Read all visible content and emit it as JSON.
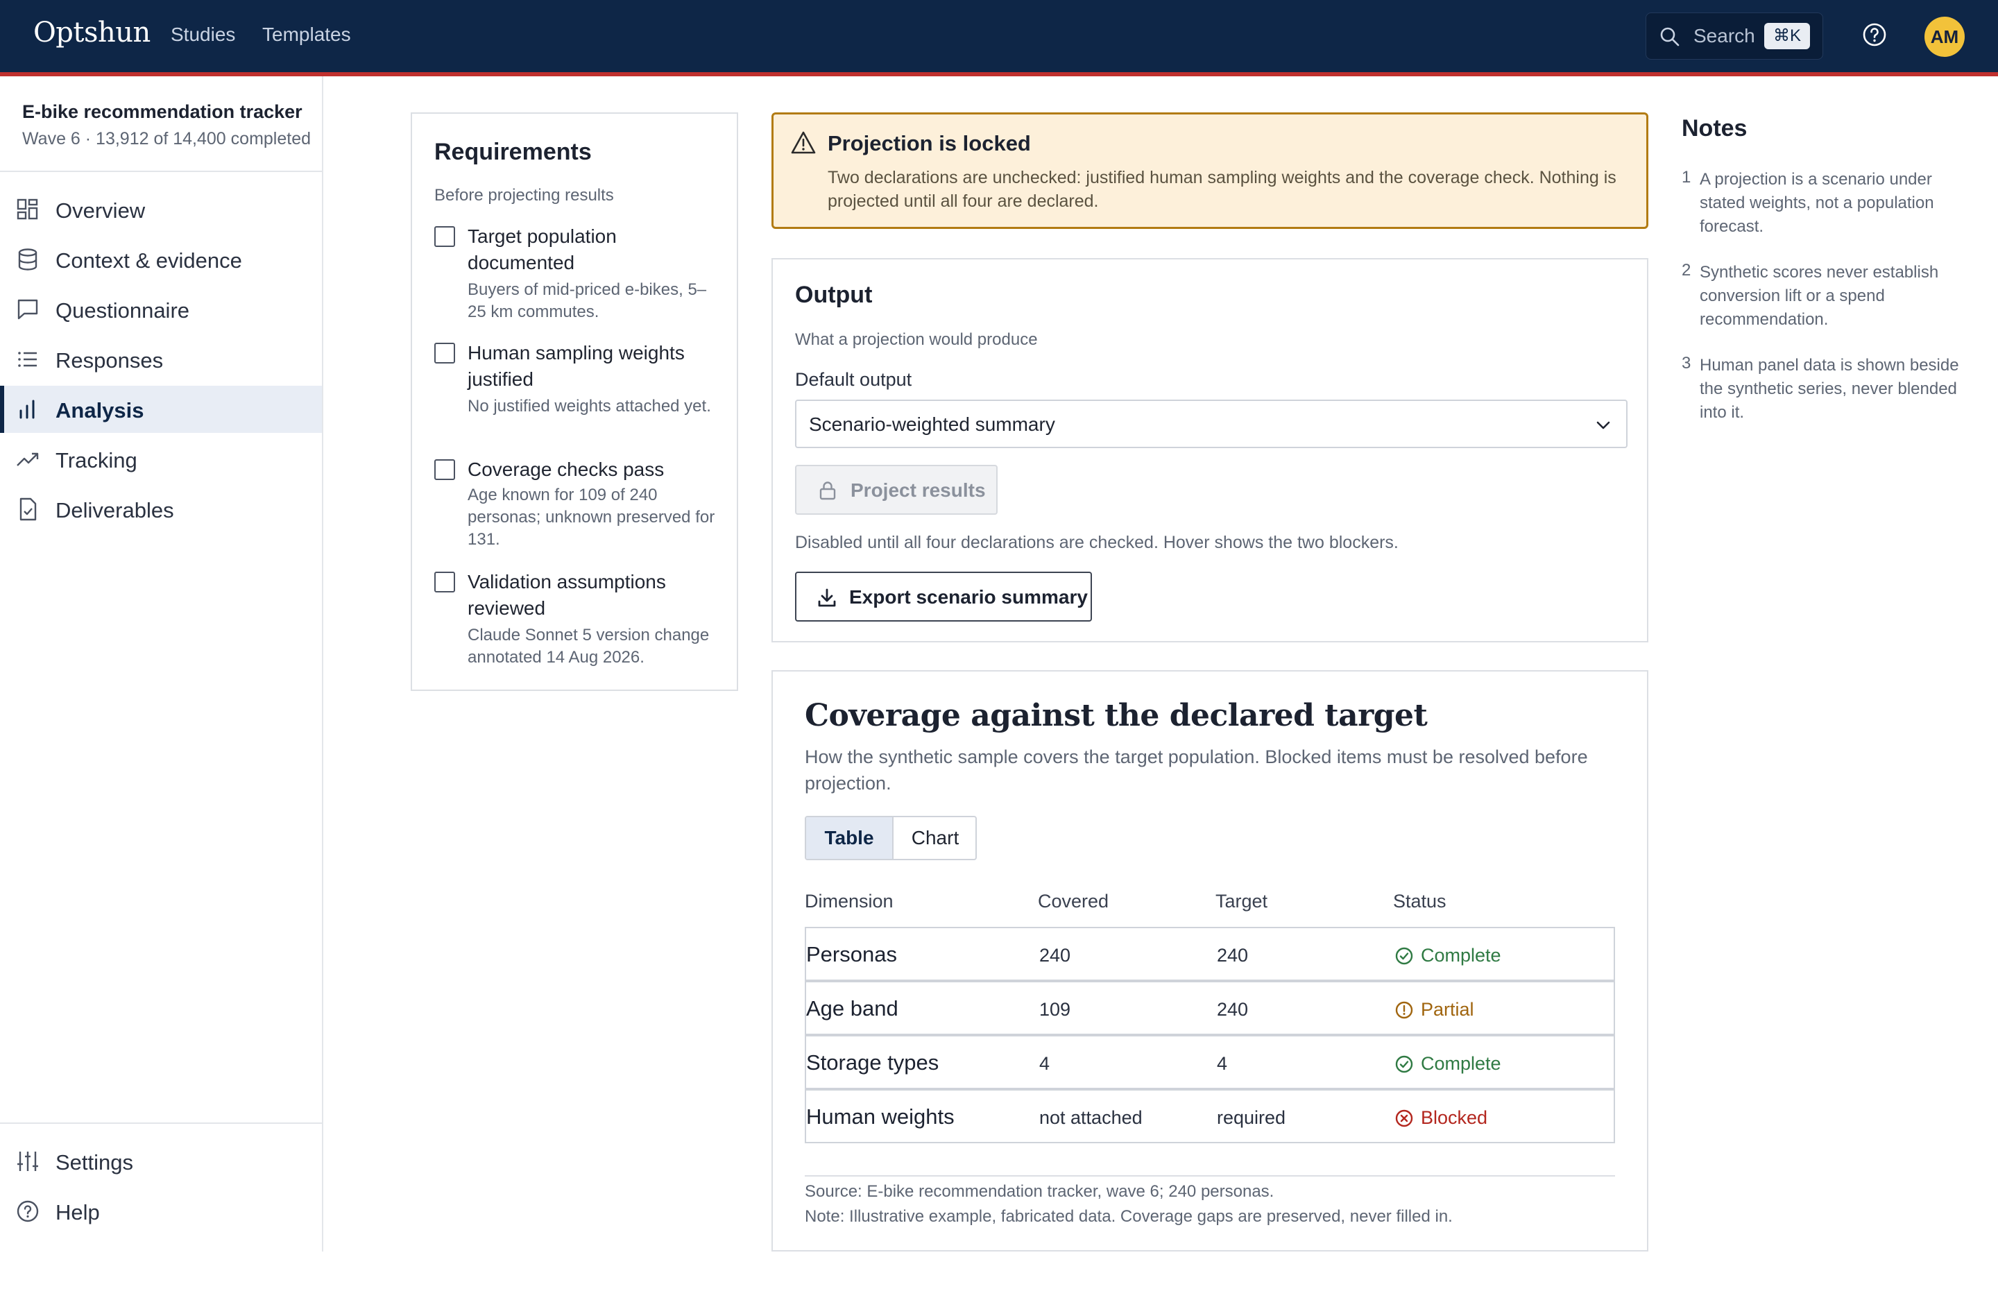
{
  "app": {
    "logo": "Optshun",
    "nav": [
      "Studies",
      "Templates"
    ],
    "search_label": "Search",
    "search_shortcut": "⌘K",
    "avatar_initials": "AM"
  },
  "study": {
    "title": "E-bike recommendation tracker",
    "meta": "Wave 6 · 13,912 of 14,400 completed"
  },
  "sidebar": {
    "items": [
      {
        "label": "Overview",
        "icon": "grid-icon"
      },
      {
        "label": "Context & evidence",
        "icon": "database-icon"
      },
      {
        "label": "Questionnaire",
        "icon": "chat-icon"
      },
      {
        "label": "Responses",
        "icon": "list-icon"
      },
      {
        "label": "Analysis",
        "icon": "bar-chart-icon",
        "active": true
      },
      {
        "label": "Tracking",
        "icon": "trend-icon"
      },
      {
        "label": "Deliverables",
        "icon": "file-check-icon"
      }
    ],
    "bottom": [
      {
        "label": "Settings",
        "icon": "sliders-icon"
      },
      {
        "label": "Help",
        "icon": "help-icon"
      }
    ]
  },
  "requirements": {
    "title": "Requirements",
    "subtitle": "Before projecting results",
    "items": [
      {
        "title": "Target population documented",
        "detail": "Buyers of mid-priced e-bikes, 5–25 km commutes.",
        "checked": false
      },
      {
        "title": "Human sampling weights justified",
        "detail": "No justified weights attached yet.",
        "checked": false
      },
      {
        "title": "Coverage checks pass",
        "detail": "Age known for 109 of 240 personas; unknown preserved for 131.",
        "checked": false
      },
      {
        "title": "Validation assumptions reviewed",
        "detail": "Claude Sonnet 5 version change annotated 14 Aug 2026.",
        "checked": false
      }
    ]
  },
  "alert": {
    "title": "Projection is locked",
    "body": "Two declarations are unchecked: justified human sampling weights and the coverage check. Nothing is projected until all four are declared."
  },
  "output": {
    "title": "Output",
    "subtitle": "What a projection would produce",
    "field_label": "Default output",
    "selected": "Scenario-weighted summary",
    "project_button": "Project results",
    "disabled_note": "Disabled until all four declarations are checked. Hover shows the two blockers.",
    "export_button": "Export scenario summary"
  },
  "coverage": {
    "title": "Coverage against the declared target",
    "subtitle": "How the synthetic sample covers the target population. Blocked items must be resolved before projection.",
    "tabs": [
      "Table",
      "Chart"
    ],
    "active_tab": "Table",
    "columns": [
      "Dimension",
      "Covered",
      "Target",
      "Status"
    ],
    "rows": [
      {
        "dimension": "Personas",
        "covered": "240",
        "target": "240",
        "status": "Complete",
        "kind": "complete"
      },
      {
        "dimension": "Age band",
        "covered": "109",
        "target": "240",
        "status": "Partial",
        "kind": "partial"
      },
      {
        "dimension": "Storage types",
        "covered": "4",
        "target": "4",
        "status": "Complete",
        "kind": "complete"
      },
      {
        "dimension": "Human weights",
        "covered": "not attached",
        "target": "required",
        "status": "Blocked",
        "kind": "blocked"
      }
    ],
    "source": "Source: E-bike recommendation tracker, wave 6; 240 personas.",
    "note": "Note: Illustrative example, fabricated data. Coverage gaps are preserved, never filled in.",
    "status_colors": {
      "complete": "#2f7a43",
      "partial": "#a0650f",
      "blocked": "#b3261e"
    }
  },
  "notes": {
    "title": "Notes",
    "items": [
      {
        "n": "1",
        "text": "A projection is a scenario under stated weights, not a population forecast."
      },
      {
        "n": "2",
        "text": "Synthetic scores never establish conversion lift or a spend recommendation."
      },
      {
        "n": "3",
        "text": "Human panel data is shown beside the synthetic series, never blended into it."
      }
    ]
  }
}
